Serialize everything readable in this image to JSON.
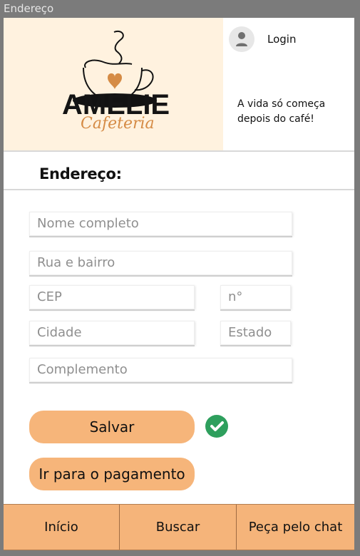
{
  "window": {
    "title": "Endereço"
  },
  "hero": {
    "brand_main": "AMELIE",
    "brand_sub": "Cafeteria",
    "login_label": "Login",
    "tagline": "A vida só começa depois do café!",
    "colors": {
      "hero_bg": "#fff2df",
      "accent": "#f6b57a",
      "accent_dark": "#d58b45"
    }
  },
  "main": {
    "section_title": "Endereço:",
    "fields": {
      "full_name_placeholder": "Nome completo",
      "street_placeholder": "Rua e bairro",
      "cep_placeholder": "CEP",
      "number_placeholder": "n°",
      "city_placeholder": "Cidade",
      "state_placeholder": "Estado",
      "complement_placeholder": "Complemento"
    },
    "buttons": {
      "save_label": "Salvar",
      "payment_label": "Ir para o pagamento"
    },
    "status": {
      "saved_icon": "check-icon",
      "saved_color": "#2e9f5d"
    }
  },
  "nav": {
    "items": [
      {
        "label": "Início"
      },
      {
        "label": "Buscar"
      },
      {
        "label": "Peça pelo chat"
      }
    ]
  }
}
